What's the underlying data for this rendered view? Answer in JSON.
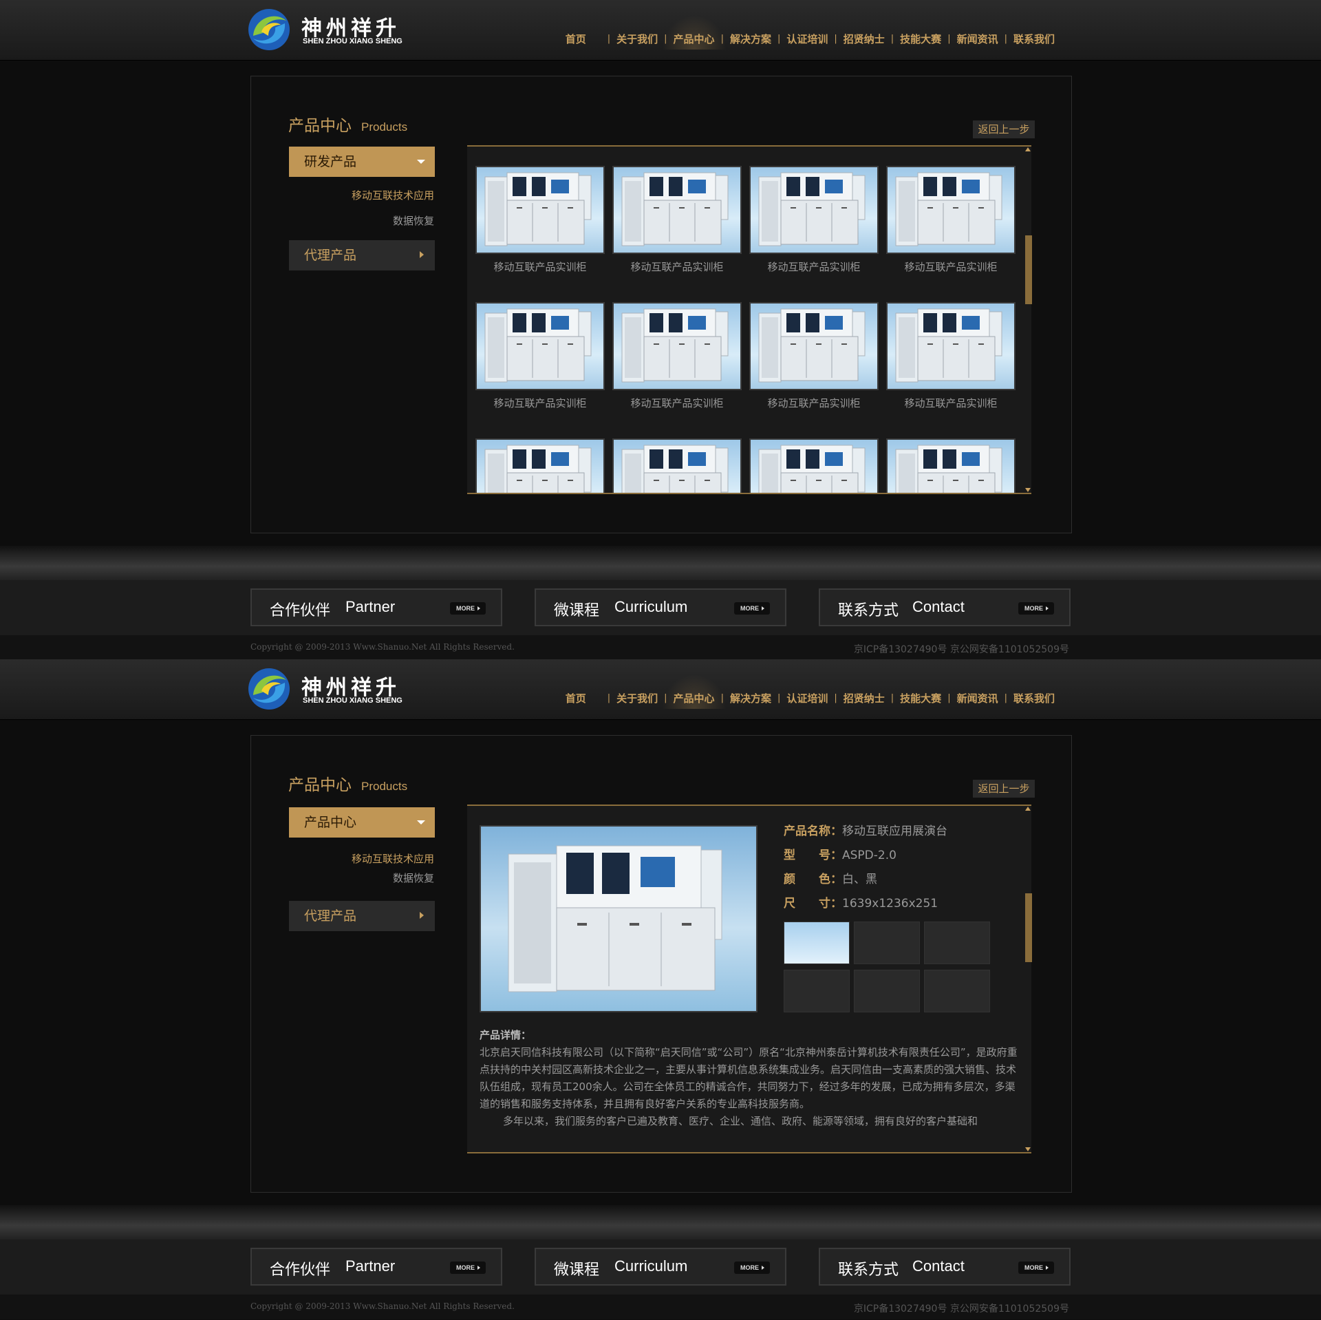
{
  "brand": {
    "name_cn": "神州祥升",
    "name_en": "SHEN ZHOU XIANG SHENG",
    "colors": {
      "accent": "#c8a060",
      "button": "#c09655",
      "background": "#0d0d0d"
    },
    "logo_icon": "swirl-logo-icon"
  },
  "nav": {
    "items": [
      "首页",
      "关于我们",
      "产品中心",
      "解决方案",
      "认证培训",
      "招贤纳士",
      "技能大赛",
      "新闻资讯",
      "联系我们"
    ],
    "active": "产品中心"
  },
  "section": {
    "title_cn": "产品中心",
    "title_en": "Products"
  },
  "back_label": "返回上一步",
  "page1": {
    "category_open": "研发产品",
    "subitems": [
      "移动互联技术应用",
      "数据恢复"
    ],
    "category_closed": "代理产品",
    "products": [
      "移动互联产品实训柜",
      "移动互联产品实训柜",
      "移动互联产品实训柜",
      "移动互联产品实训柜",
      "移动互联产品实训柜",
      "移动互联产品实训柜",
      "移动互联产品实训柜",
      "移动互联产品实训柜",
      "",
      "",
      "",
      ""
    ]
  },
  "page2": {
    "category_open": "产品中心",
    "subitems": [
      "移动互联技术应用",
      "数据恢复"
    ],
    "category_closed": "代理产品",
    "specs": [
      {
        "label": "产品名称：",
        "value": "移动互联应用展演台"
      },
      {
        "label": "型　　号：",
        "value": "ASPD-2.0"
      },
      {
        "label": "颜　　色：",
        "value": "白、黑"
      },
      {
        "label": "尺　　寸：",
        "value": "1639x1236x251"
      }
    ],
    "detail_heading": "产品详情：",
    "detail_paragraphs": [
      "北京启天同信科技有限公司（以下简称“启天同信”或“公司”）原名“北京神州泰岳计算机技术有限责任公司”，是政府重点扶持的中关村园区高新技术企业之一，主要从事计算机信息系统集成业务。启天同信由一支高素质的强大销售、技术队伍组成，现有员工200余人。公司在全体员工的精诚合作，共同努力下，经过多年的发展，已成为拥有多层次，多渠道的销售和服务支持体系，并且拥有良好客户关系的专业高科技服务商。",
      "多年以来，我们服务的客户已遍及教育、医疗、企业、通信、政府、能源等领域，拥有良好的客户基础和"
    ]
  },
  "footer": {
    "boxes": [
      {
        "cn": "合作伙伴",
        "en": "Partner",
        "more": "MORE"
      },
      {
        "cn": "微课程",
        "en": "Curriculum",
        "more": "MORE"
      },
      {
        "cn": "联系方式",
        "en": "Contact",
        "more": "MORE"
      }
    ],
    "copyright": "Copyright @ 2009-2013 Www.Shanuo.Net All Rights Reserved.",
    "icp": "京ICP备13027490号 京公网安备1101052509号"
  }
}
